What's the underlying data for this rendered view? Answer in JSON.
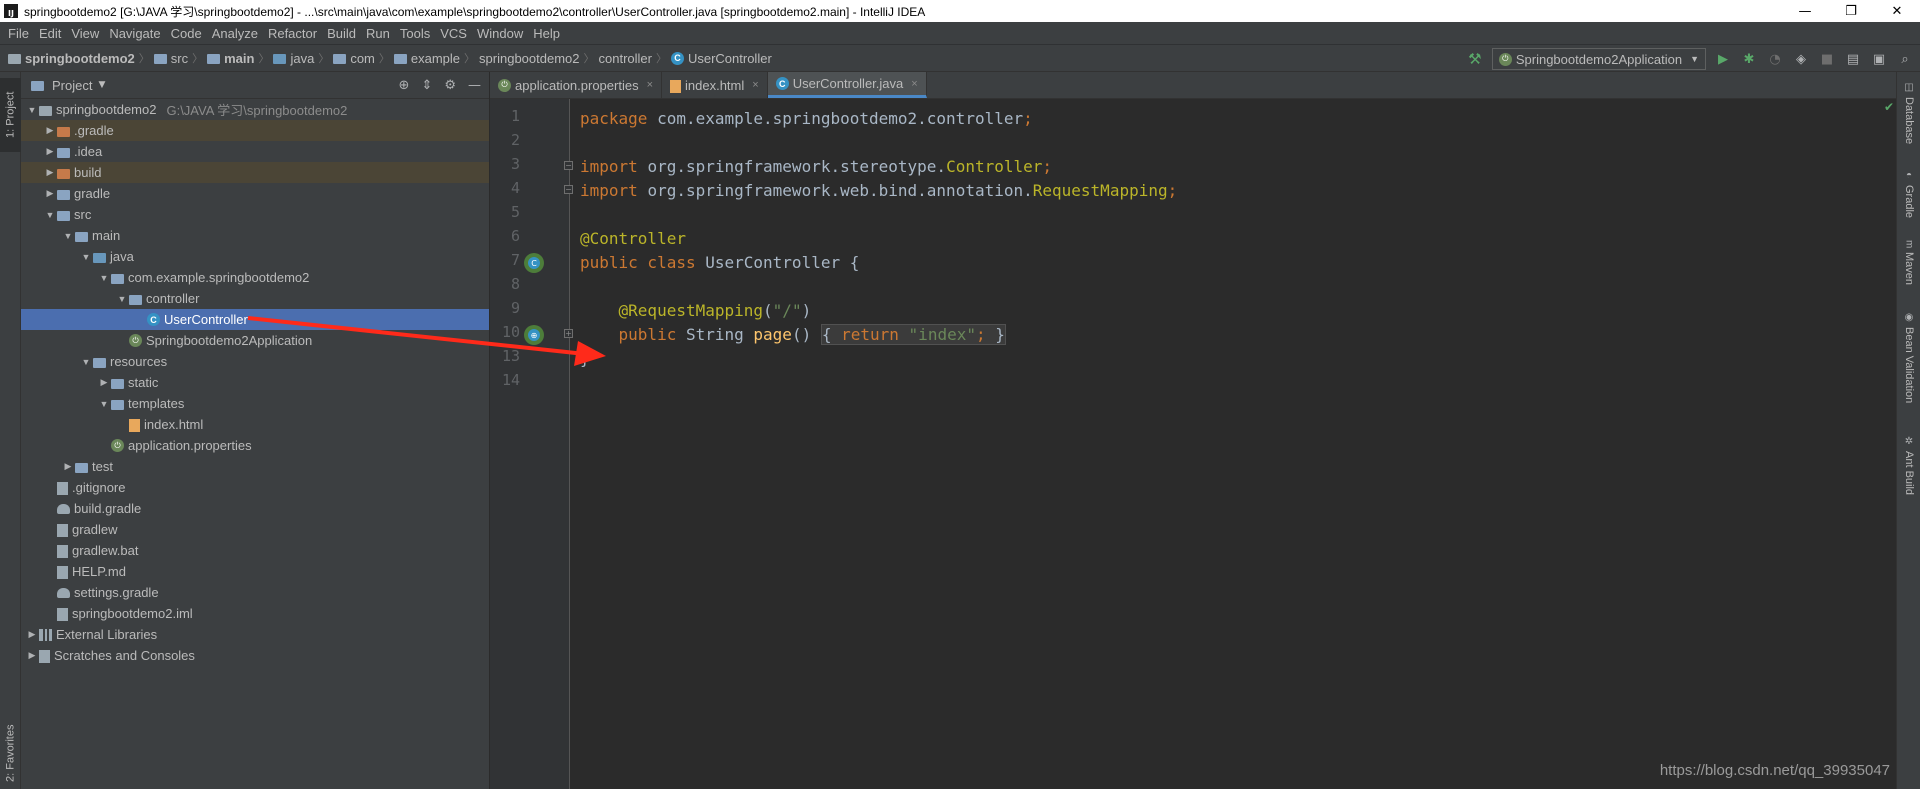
{
  "window": {
    "title": "springbootdemo2 [G:\\JAVA 学习\\springbootdemo2] - ...\\src\\main\\java\\com\\example\\springbootdemo2\\controller\\UserController.java [springbootdemo2.main] - IntelliJ IDEA",
    "minimize": "—",
    "restore": "❐",
    "close": "✕"
  },
  "menu": [
    "File",
    "Edit",
    "View",
    "Navigate",
    "Code",
    "Analyze",
    "Refactor",
    "Build",
    "Run",
    "Tools",
    "VCS",
    "Window",
    "Help"
  ],
  "breadcrumbs": [
    "springbootdemo2",
    "src",
    "main",
    "java",
    "com",
    "example",
    "springbootdemo2",
    "controller",
    "UserController"
  ],
  "run_config": "Springbootdemo2Application",
  "left_stripe": {
    "project": "1: Project",
    "favorites": "2: Favorites"
  },
  "project_panel": {
    "title": "Project",
    "tree": [
      {
        "label": "springbootdemo2",
        "hint": "G:\\JAVA 学习\\springbootdemo2",
        "depth": 0,
        "arrow": "▼",
        "icon": "root"
      },
      {
        "label": ".gradle",
        "depth": 1,
        "arrow": "▶",
        "icon": "orange",
        "highlight": true
      },
      {
        "label": ".idea",
        "depth": 1,
        "arrow": "▶",
        "icon": "folder"
      },
      {
        "label": "build",
        "depth": 1,
        "arrow": "▶",
        "icon": "orange",
        "highlight": true
      },
      {
        "label": "gradle",
        "depth": 1,
        "arrow": "▶",
        "icon": "folder"
      },
      {
        "label": "src",
        "depth": 1,
        "arrow": "▼",
        "icon": "folder"
      },
      {
        "label": "main",
        "depth": 2,
        "arrow": "▼",
        "icon": "folder"
      },
      {
        "label": "java",
        "depth": 3,
        "arrow": "▼",
        "icon": "blue"
      },
      {
        "label": "com.example.springbootdemo2",
        "depth": 4,
        "arrow": "▼",
        "icon": "folder"
      },
      {
        "label": "controller",
        "depth": 5,
        "arrow": "▼",
        "icon": "folder"
      },
      {
        "label": "UserController",
        "depth": 6,
        "arrow": "",
        "icon": "class",
        "selected": true
      },
      {
        "label": "Springbootdemo2Application",
        "depth": 5,
        "arrow": "",
        "icon": "spring"
      },
      {
        "label": "resources",
        "depth": 3,
        "arrow": "▼",
        "icon": "folder"
      },
      {
        "label": "static",
        "depth": 4,
        "arrow": "▶",
        "icon": "folder"
      },
      {
        "label": "templates",
        "depth": 4,
        "arrow": "▼",
        "icon": "folder"
      },
      {
        "label": "index.html",
        "depth": 5,
        "arrow": "",
        "icon": "html"
      },
      {
        "label": "application.properties",
        "depth": 4,
        "arrow": "",
        "icon": "spring"
      },
      {
        "label": "test",
        "depth": 2,
        "arrow": "▶",
        "icon": "folder"
      },
      {
        "label": ".gitignore",
        "depth": 1,
        "arrow": "",
        "icon": "file"
      },
      {
        "label": "build.gradle",
        "depth": 1,
        "arrow": "",
        "icon": "gradle"
      },
      {
        "label": "gradlew",
        "depth": 1,
        "arrow": "",
        "icon": "file"
      },
      {
        "label": "gradlew.bat",
        "depth": 1,
        "arrow": "",
        "icon": "file"
      },
      {
        "label": "HELP.md",
        "depth": 1,
        "arrow": "",
        "icon": "file"
      },
      {
        "label": "settings.gradle",
        "depth": 1,
        "arrow": "",
        "icon": "gradle"
      },
      {
        "label": "springbootdemo2.iml",
        "depth": 1,
        "arrow": "",
        "icon": "file"
      },
      {
        "label": "External Libraries",
        "depth": 0,
        "arrow": "▶",
        "icon": "lib"
      },
      {
        "label": "Scratches and Consoles",
        "depth": 0,
        "arrow": "▶",
        "icon": "file"
      }
    ]
  },
  "tabs": [
    {
      "label": "application.properties",
      "icon": "spring",
      "active": false
    },
    {
      "label": "index.html",
      "icon": "html",
      "active": false
    },
    {
      "label": "UserController.java",
      "icon": "class",
      "active": true
    }
  ],
  "editor": {
    "line_numbers": [
      "1",
      "2",
      "3",
      "4",
      "5",
      "6",
      "7",
      "8",
      "9",
      "10",
      "13",
      "14"
    ]
  },
  "right_stripe": [
    "Database",
    "Gradle",
    "Maven",
    "Bean Validation",
    "Ant Build"
  ],
  "watermark": "https://blog.csdn.net/qq_39935047",
  "colors": {
    "keyword": "#cc7832",
    "annotation": "#bbb529",
    "string": "#6a8759",
    "method": "#ffc66d",
    "selection": "#4b6eaf",
    "arrow": "#ff2a1a"
  }
}
